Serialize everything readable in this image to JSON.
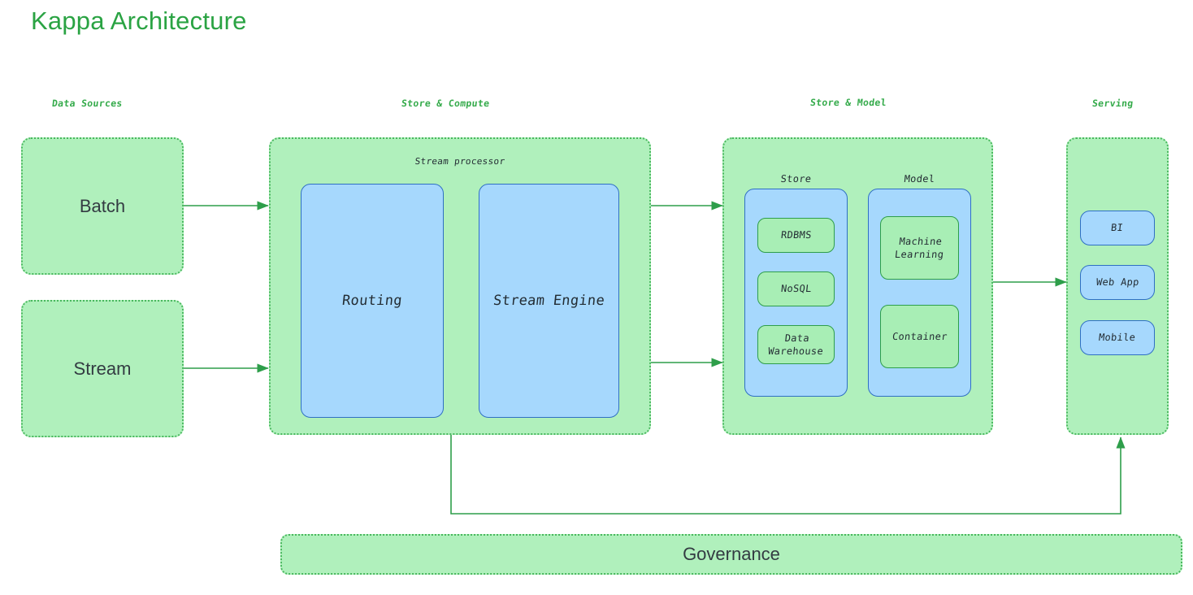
{
  "page": {
    "title": "Kappa Architecture",
    "title_color": "#2aa343",
    "background": "#ffffff"
  },
  "palette": {
    "green_fill": "#b0f0bc",
    "green_border": "#49b85e",
    "green_solid_border": "#2e9e4a",
    "blue_fill": "#a6d8fd",
    "blue_border": "#2f6fc4",
    "arrow_color": "#2e9e4a",
    "text_dark": "#232c33",
    "label_green": "#35ab4b"
  },
  "column_labels": [
    {
      "id": "data-sources",
      "text": "Data Sources"
    },
    {
      "id": "store-compute",
      "text": "Store & Compute"
    },
    {
      "id": "store-model",
      "text": "Store & Model"
    },
    {
      "id": "serving",
      "text": "Serving"
    }
  ],
  "data_sources": {
    "batch": "Batch",
    "stream": "Stream"
  },
  "store_compute": {
    "group_label": "Stream processor",
    "routing": "Routing",
    "stream_engine": "Stream Engine"
  },
  "store_model": {
    "store_label": "Store",
    "model_label": "Model",
    "store_items": [
      "RDBMS",
      "NoSQL",
      "Data Warehouse"
    ],
    "model_items": [
      "Machine Learning",
      "Container"
    ]
  },
  "serving": {
    "items": [
      "BI",
      "Web App",
      "Mobile"
    ]
  },
  "governance": {
    "label": "Governance"
  }
}
